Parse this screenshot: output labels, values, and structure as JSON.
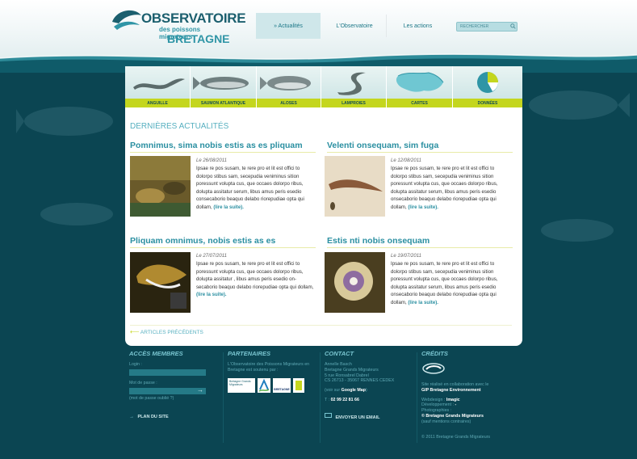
{
  "header": {
    "logo": {
      "line1": "OBSERVATOIRE",
      "line2": "des poissons migrateurs",
      "line3": "BRETAGNE"
    },
    "nav": [
      {
        "label": "» Actualités",
        "active": true
      },
      {
        "label": "L'Observatoire",
        "active": false
      },
      {
        "label": "Les actions",
        "active": false
      }
    ],
    "search": {
      "placeholder": "RECHERCHER"
    }
  },
  "species": [
    {
      "label": "ANGUILLE",
      "icon": "eel-icon"
    },
    {
      "label": "SAUMON ATLANTIQUE",
      "icon": "salmon-icon"
    },
    {
      "label": "ALOSES",
      "icon": "shad-icon"
    },
    {
      "label": "LAMPROIES",
      "icon": "lamprey-icon"
    },
    {
      "label": "CARTES",
      "icon": "brittany-map-icon"
    },
    {
      "label": "DONNÉES",
      "icon": "pie-chart-icon"
    }
  ],
  "main": {
    "section_title": "DERNIÈRES ACTUALITÉS",
    "articles": [
      {
        "title": "Pomnimus, sima nobis estis as es pliquam",
        "date": "Le 26/08/2011",
        "body": "Ipsae re pos susam, te rere pro et lit est offici to dolorpo stibus sam, secepudia veniminus sition poressunt volupta cus, que occaes dolorpo ribus, dolupta assitatur serum, libus amus peris esedio consecaborio beaquo delabo riorepudiae opta qui dollam,",
        "more": "(lire la suite)."
      },
      {
        "title": "Velenti onsequam, sim fuga",
        "date": "Le 12/08/2011",
        "body": "Ipsae re pos susam, te rere pro et lit est offici to dolorpo stibus sam, secepudia veniminus sition poressunt volupta cus, que occaes dolorpo ribus, dolupta assitatur serum, libus amus peris esedio onsecaborio beaquo delabo riorepudiae opta qui dollam,",
        "more": "(lire la suite)."
      },
      {
        "title": "Pliquam omnimus, nobis estis as es",
        "date": "Le 27/07/2011",
        "body": "Ipsae re pos susam, te rere pro et lit est offici to poressunt volupta cus, que occaes dolorpo ribus, dolupta assitatur , libus amus peris esedio on-secaborio beaquo delabo riorepudiae opta qui dollam,",
        "more": "(lire la suite)."
      },
      {
        "title": "Estis nti nobis onsequam",
        "date": "Le 19/07/2011",
        "body": "Ipsae re pos susam, te rere pro et lit est offici to dolorpo stibus sam, secepudia veniminus sition poressunt volupta cus, que occaes dolorpo ribus, dolupta assitatur serum, libus amus peris esedio onsecaborio beaquo delabo riorepudiae opta qui dollam,",
        "more": "(lire la suite)."
      }
    ],
    "previous_label": "ARTICLES PRÉCÉDENTS"
  },
  "footer": {
    "members": {
      "title": "ACCÈS MEMBRES",
      "login_label": "Login :",
      "password_label": "Mot de passe :",
      "forgot": "(mot de passe oublié ?)",
      "sitemap": "PLAN DU SITE"
    },
    "partners": {
      "title": "PARTENAIRES",
      "text": "L'Observatoire des Poissons Migrateurs en Bretagne est soutenu par :",
      "logo1": "Bretagne Grands Migrateurs",
      "logo2": "BRETAGNE"
    },
    "contact": {
      "title": "CONTACT",
      "name": "Annelle Basch",
      "org": "Bretagne Grands Migrateurs",
      "street": "5 rue Ronsabrel Dabrel",
      "city": "CS 26713 - 35067 RENNES CEDEX",
      "map_prefix": "(voir sur",
      "map_link": "Google Map",
      "map_suffix": ")",
      "phone_prefix": "T :",
      "phone": "02 99 22 81 66",
      "email": "ENVOYER UN EMAIL"
    },
    "credits": {
      "title": "CRÉDITS",
      "made_with": "Site réalisé en collaboration avec le",
      "gip": "GIP Bretagne Environnement",
      "webdesign_label": "Webdesign :",
      "webdesign": "Imagic",
      "dev_label": "Développement :",
      "dev": "-",
      "photo_label": "Photographies :",
      "photo": "© Bretagne Grands Migrateurs",
      "photo_note": "(sauf mentions contraires)",
      "copyright": "© 2011 Bretagne Grands Migrateurs"
    }
  }
}
